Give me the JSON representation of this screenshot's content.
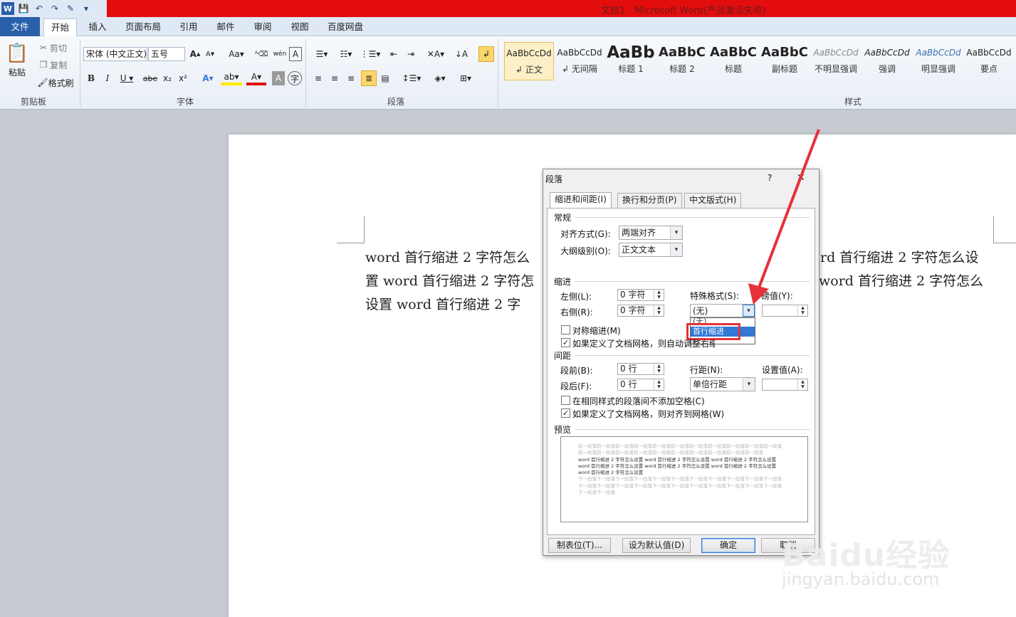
{
  "window": {
    "title": "文档1 - Microsoft Word(产品激活失败)"
  },
  "tabs": [
    "文件",
    "开始",
    "插入",
    "页面布局",
    "引用",
    "邮件",
    "审阅",
    "视图",
    "百度网盘"
  ],
  "clipboard": {
    "paste": "粘贴",
    "cut": "剪切",
    "copy": "复制",
    "format_painter": "格式刷",
    "group": "剪贴板"
  },
  "font": {
    "name": "宋体 (中文正文)",
    "size": "五号",
    "group": "字体"
  },
  "paragraph_group": "段落",
  "styles": {
    "group": "样式",
    "items": [
      {
        "sample": "AaBbCcDd",
        "name": "正文"
      },
      {
        "sample": "AaBbCcDd",
        "name": "无间隔"
      },
      {
        "sample": "AaBb",
        "name": "标题 1"
      },
      {
        "sample": "AaBbC",
        "name": "标题 2"
      },
      {
        "sample": "AaBbC",
        "name": "标题"
      },
      {
        "sample": "AaBbC",
        "name": "副标题"
      },
      {
        "sample": "AaBbCcDd",
        "name": "不明显强调"
      },
      {
        "sample": "AaBbCcDd",
        "name": "强调"
      },
      {
        "sample": "AaBbCcDd",
        "name": "明显强调"
      },
      {
        "sample": "AaBbCcDd",
        "name": "要点"
      }
    ]
  },
  "document": {
    "lines": [
      {
        "left": "word 首行缩进 2 字符怎么",
        "right": "rd 首行缩进 2 字符怎么设"
      },
      {
        "left": "置 word 首行缩进 2 字符怎",
        "right": "word 首行缩进 2 字符怎么"
      },
      {
        "left": "设置 word 首行缩进 2 字",
        "right": ""
      }
    ]
  },
  "dialog": {
    "title": "段落",
    "help": "?",
    "close": "✕",
    "tabs": [
      "缩进和间距(I)",
      "换行和分页(P)",
      "中文版式(H)"
    ],
    "general": {
      "heading": "常规",
      "align_label": "对齐方式(G):",
      "align_value": "两端对齐",
      "outline_label": "大纲级别(O):",
      "outline_value": "正文文本"
    },
    "indent": {
      "heading": "缩进",
      "left_label": "左侧(L):",
      "left_value": "0 字符",
      "right_label": "右侧(R):",
      "right_value": "0 字符",
      "special_label": "特殊格式(S):",
      "special_value": "(无)",
      "by_label": "磅值(Y):",
      "options": [
        "(无)",
        "首行缩进"
      ],
      "mirror": "对称缩进(M)",
      "auto_adjust": "如果定义了文档网格，则自动调整右缩进(D)"
    },
    "spacing": {
      "heading": "间距",
      "before_label": "段前(B):",
      "before_value": "0 行",
      "after_label": "段后(F):",
      "after_value": "0 行",
      "line_label": "行距(N):",
      "line_value": "单倍行距",
      "at_label": "设置值(A):",
      "no_space": "在相同样式的段落间不添加空格(C)",
      "snap": "如果定义了文档网格，则对齐到网格(W)"
    },
    "preview": {
      "heading": "预览",
      "prev": "前一段落前一段落前一段落前一段落前一段落前一段落前一段落前一段落前一段落前一段落前一段落前一段落前一段落前一段落前一段落前一段落前一段落前一段落前一段落前一段落前一段落",
      "current": "word 首行缩进 2 字符怎么设置 word 首行缩进 2 字符怎么设置 word 首行缩进 2 字符怎么设置 word 首行缩进 2 字符怎么设置 word 首行缩进 2 字符怎么设置 word 首行缩进 2 字符怎么设置 word 首行缩进 2 字符怎么设置",
      "next": "下一段落下一段落下一段落下一段落下一段落下一段落下一段落下一段落下一段落下一段落下一段落下一段落下一段落下一段落下一段落下一段落下一段落下一段落下一段落下一段落下一段落下一段落下一段落下一段落"
    },
    "buttons": {
      "tabs": "制表位(T)...",
      "default": "设为默认值(D)",
      "ok": "确定",
      "cancel": "取消"
    }
  },
  "watermark": {
    "brand": "Baidu经验",
    "url": "jingyan.baidu.com"
  },
  "colors": {
    "title_bar": "#e40d0d",
    "highlight": "#e53238",
    "selection": "#3178d4"
  }
}
